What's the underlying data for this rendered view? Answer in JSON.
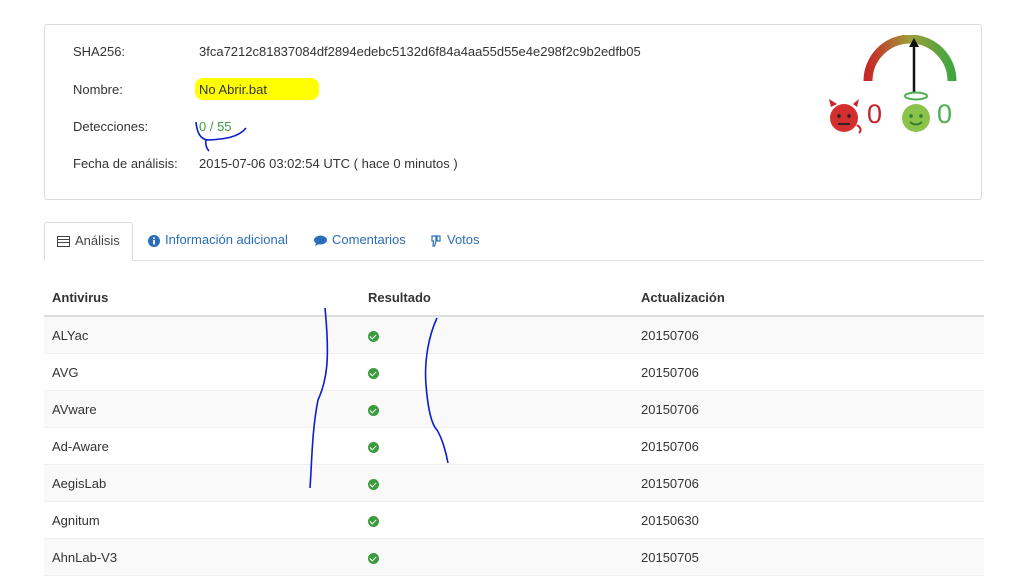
{
  "file_info": {
    "sha256_label": "SHA256:",
    "sha256_value": "3fca7212c81837084df2894edebc5132d6f84a4aa55d55e4e298f2c9b2edfb05",
    "name_label": "Nombre:",
    "name_value": "No Abrir.bat",
    "detections_label": "Detecciones:",
    "detections_value": "0 / 55",
    "date_label": "Fecha de análisis:",
    "date_value": "2015-07-06 03:02:54 UTC ( hace 0 minutos )"
  },
  "votes": {
    "malicious_count": "0",
    "harmless_count": "0",
    "malicious_icon": "devil-face-icon",
    "harmless_icon": "angel-face-icon"
  },
  "tabs": [
    {
      "label": "Análisis",
      "icon": "table-icon",
      "active": true
    },
    {
      "label": "Información adicional",
      "icon": "info-circle-icon",
      "active": false
    },
    {
      "label": "Comentarios",
      "icon": "comment-icon",
      "active": false
    },
    {
      "label": "Votos",
      "icon": "thumbs-icon",
      "active": false
    }
  ],
  "table": {
    "headers": [
      "Antivirus",
      "Resultado",
      "Actualización"
    ],
    "rows": [
      {
        "antivirus": "ALYac",
        "update": "20150706"
      },
      {
        "antivirus": "AVG",
        "update": "20150706"
      },
      {
        "antivirus": "AVware",
        "update": "20150706"
      },
      {
        "antivirus": "Ad-Aware",
        "update": "20150706"
      },
      {
        "antivirus": "AegisLab",
        "update": "20150706"
      },
      {
        "antivirus": "Agnitum",
        "update": "20150630"
      },
      {
        "antivirus": "AhnLab-V3",
        "update": "20150705"
      }
    ]
  },
  "colors": {
    "link": "#2a6ebb",
    "clean_green": "#3c9b3c",
    "malicious_red": "#c0272d",
    "highlight_yellow": "#ffff00",
    "annotation_blue": "#0a1ecc"
  }
}
